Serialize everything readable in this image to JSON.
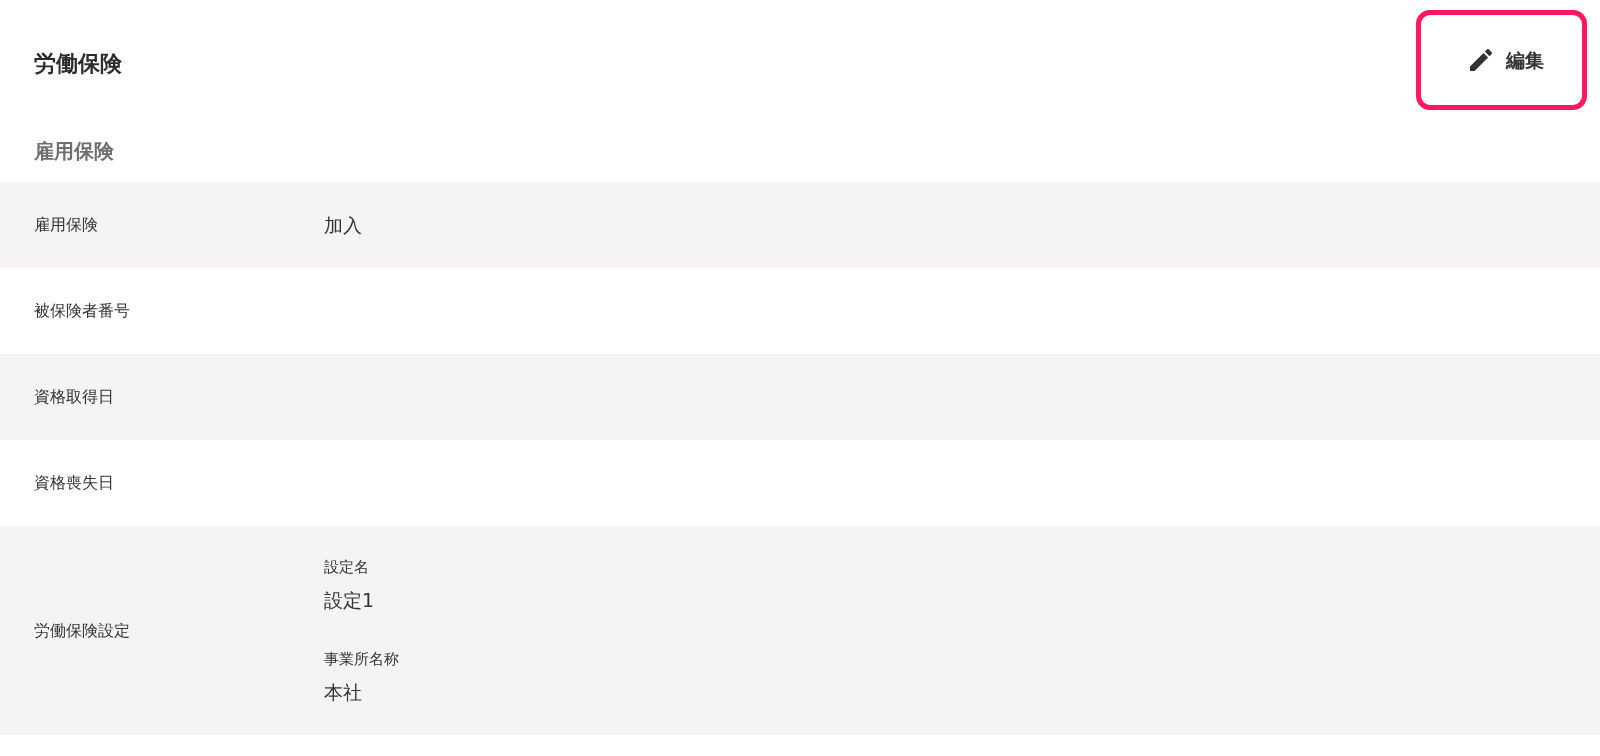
{
  "header": {
    "title": "労働保険",
    "edit_button": {
      "label": "編集",
      "highlighted": true
    }
  },
  "section": {
    "title": "雇用保険"
  },
  "rows": [
    {
      "kind": "value",
      "label": "雇用保険",
      "value": "加入"
    },
    {
      "kind": "value",
      "label": "被保険者番号"
    },
    {
      "kind": "value",
      "label": "資格取得日"
    },
    {
      "kind": "value",
      "label": "資格喪失日"
    },
    {
      "kind": "group",
      "label": "労働保険設定",
      "fields": [
        {
          "label": "設定名",
          "value": "設定1"
        },
        {
          "label": "事業所名称",
          "value": "本社"
        }
      ]
    }
  ]
}
